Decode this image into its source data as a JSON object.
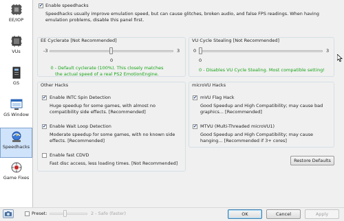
{
  "sidebar": {
    "items": [
      {
        "label": "EE/IOP",
        "icon": "chip-icon"
      },
      {
        "label": "VUs",
        "icon": "vu-chip-icon"
      },
      {
        "label": "GS",
        "icon": "monitor-stack-icon"
      },
      {
        "label": "GS Window",
        "icon": "window-icon"
      },
      {
        "label": "Speedhacks",
        "icon": "speedhacks-icon"
      },
      {
        "label": "Game Fixes",
        "icon": "game-fixes-icon"
      }
    ]
  },
  "speedhacks": {
    "enable_label": "Enable speedhacks",
    "enable_checked": true,
    "warning": "Speedhacks usually improve emulation speed, but can cause glitches, broken audio, and false FPS readings.  When having emulation problems, disable this panel first."
  },
  "ee_cyclerate": {
    "title": "EE Cyclerate [Not Recommended]",
    "min": "-3",
    "max": "3",
    "value": "0",
    "value_fraction": 0.5,
    "description": "0 - Default cyclerate (100%). This closely matches the actual speed of a real PS2 EmotionEngine."
  },
  "vu_cycle_stealing": {
    "title": "VU Cycle Stealing [Not Recommended]",
    "min": "0",
    "max": "3",
    "value": "0",
    "value_fraction": 0.0,
    "description": "0 - Disables VU Cycle Stealing.  Most compatible setting!"
  },
  "other_hacks": {
    "title": "Other Hacks",
    "items": [
      {
        "label": "Enable INTC Spin Detection",
        "checked": true,
        "description": "Huge speedup for some games, with almost no compatibility side effects. [Recommended]"
      },
      {
        "label": "Enable Wait Loop Detection",
        "checked": true,
        "description": "Moderate speedup for some games, with no known side effects. [Recommended]"
      },
      {
        "label": "Enable fast CDVD",
        "checked": false,
        "description": "Fast disc access, less loading times. [Not Recommended]"
      }
    ]
  },
  "microvu_hacks": {
    "title": "microVU Hacks",
    "items": [
      {
        "label": "mVU Flag Hack",
        "checked": true,
        "description": "Good Speedup and High Compatibility; may cause bad graphics... [Recommended]"
      },
      {
        "label": "MTVU (Multi-Threaded microVU1)",
        "checked": true,
        "description": "Good Speedup and High Compatibility; may cause hanging... [Recommended if 3+ cores]"
      }
    ]
  },
  "restore_defaults_label": "Restore Defaults",
  "footer": {
    "preset_label": "Preset:",
    "preset_checked": false,
    "preset_value": "2 - Safe (faster)",
    "preset_fraction": 0.4,
    "ok_label": "OK",
    "cancel_label": "Cancel",
    "apply_label": "Apply"
  },
  "colors": {
    "accent_green": "#17a317",
    "selected_bg": "#cfe3fb"
  }
}
